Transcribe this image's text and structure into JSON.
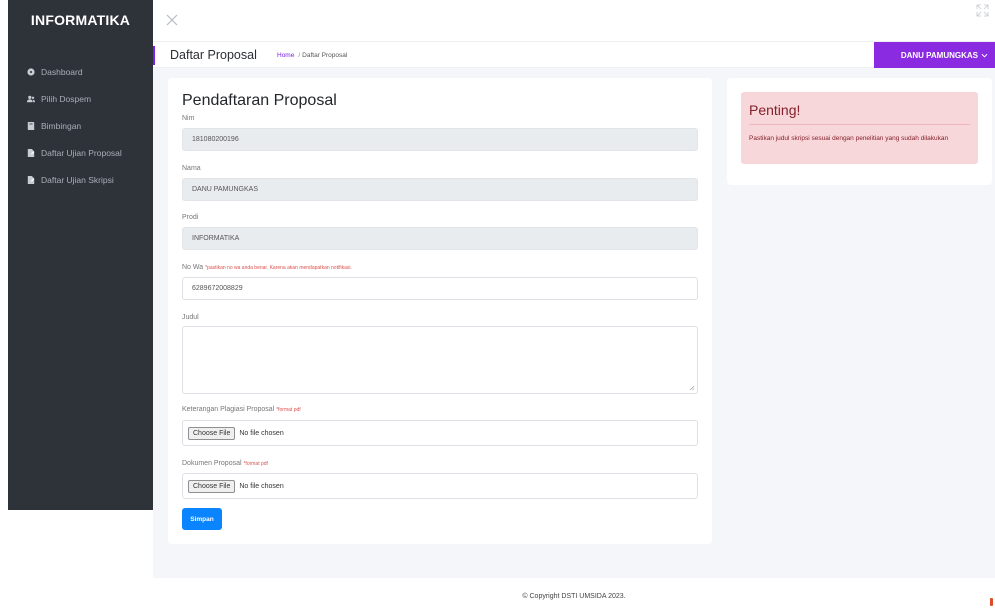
{
  "app": {
    "brand": "INFORMATIKA"
  },
  "sidebar": {
    "items": [
      {
        "label": "Dashboard",
        "icon": "dashboard-icon"
      },
      {
        "label": "Pilih Dospem",
        "icon": "users-icon"
      },
      {
        "label": "Bimbingan",
        "icon": "book-icon"
      },
      {
        "label": "Daftar Ujian Proposal",
        "icon": "file-icon"
      },
      {
        "label": "Daftar Ujian Skripsi",
        "icon": "file-icon"
      }
    ]
  },
  "header": {
    "title": "Daftar Proposal",
    "breadcrumb_home": "Home",
    "breadcrumb_sep": "/",
    "breadcrumb_current": "Daftar Proposal",
    "user": "DANU PAMUNGKAS"
  },
  "form": {
    "title": "Pendaftaran Proposal",
    "nim": {
      "label": "Nim",
      "value": "181080200196"
    },
    "nama": {
      "label": "Nama",
      "value": "DANU PAMUNGKAS"
    },
    "prodi": {
      "label": "Prodi",
      "value": "INFORMATIKA"
    },
    "nowa": {
      "label": "No Wa",
      "hint": "*pastikan no wa anda benar. Karena akan mendapatkan notifikasi.",
      "value": "6289672008829"
    },
    "judul": {
      "label": "Judul",
      "value": ""
    },
    "plagiasi": {
      "label": "Keterangan Plagiasi Proposal",
      "hint": "*format pdf",
      "button": "Choose File",
      "status": "No file chosen"
    },
    "dokumen": {
      "label": "Dokumen Proposal",
      "hint": "*format pdf",
      "button": "Choose File",
      "status": "No file chosen"
    },
    "submit": "Simpan"
  },
  "alert": {
    "title": "Penting!",
    "text": "Pastikan judul skripsi sesuai dengan penelitian yang sudah dilakukan"
  },
  "footer": {
    "text": "© Copyright DSTI UMSIDA 2023."
  },
  "colors": {
    "sidebar": "#2e333a",
    "accent": "#8a2be2",
    "primary": "#0a84ff",
    "alert_bg": "#f8d7da"
  }
}
